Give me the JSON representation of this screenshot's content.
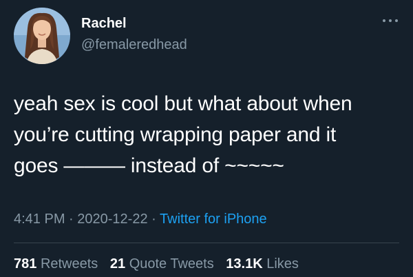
{
  "user": {
    "name": "Rachel",
    "handle": "@femaleredhead"
  },
  "tweet": {
    "lines": [
      "yeah sex is cool but what about when",
      "you’re cutting wrapping paper and it",
      "goes ——— instead of ~~~~~"
    ]
  },
  "meta": {
    "time": "4:41 PM",
    "sep1": "·",
    "date": "2020-12-22",
    "sep2": "·",
    "source": "Twitter for iPhone"
  },
  "stats": {
    "retweets_count": "781",
    "retweets_label": "Retweets",
    "quotes_count": "21",
    "quotes_label": "Quote Tweets",
    "likes_count": "13.1K",
    "likes_label": "Likes"
  },
  "colors": {
    "background": "#15202b",
    "text": "#ffffff",
    "muted": "#8899a6",
    "link": "#1da1f2",
    "divider": "#38444d"
  },
  "icons": {
    "more": "more-options-icon"
  }
}
